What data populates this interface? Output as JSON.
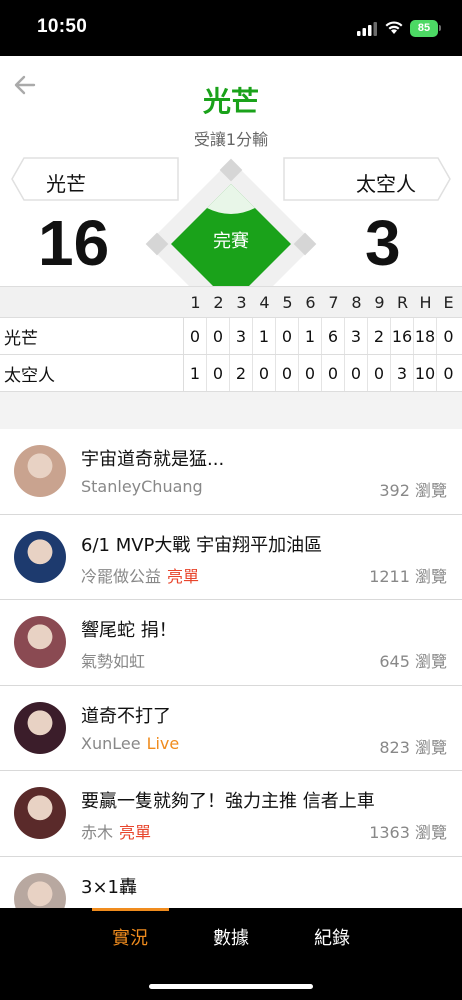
{
  "status_bar": {
    "time": "10:50",
    "battery": "85"
  },
  "header": {
    "title": "光芒",
    "handicap": "受讓1分輸",
    "home_team": "光芒",
    "away_team": "太空人",
    "home_score": "16",
    "away_score": "3",
    "game_status": "完賽",
    "accent_color": "#1aa21a"
  },
  "linescore": {
    "columns": [
      "1",
      "2",
      "3",
      "4",
      "5",
      "6",
      "7",
      "8",
      "9",
      "R",
      "H",
      "E"
    ],
    "rows": [
      {
        "team": "光芒",
        "cells": [
          "0",
          "0",
          "3",
          "1",
          "0",
          "1",
          "6",
          "3",
          "2",
          "16",
          "18",
          "0"
        ]
      },
      {
        "team": "太空人",
        "cells": [
          "1",
          "0",
          "2",
          "0",
          "0",
          "0",
          "0",
          "0",
          "0",
          "3",
          "10",
          "0"
        ]
      }
    ]
  },
  "posts": [
    {
      "title": "宇宙道奇就是猛...",
      "author": "StanleyChuang",
      "tag": "",
      "views": "392 瀏覽",
      "avatar_color": "#c9a38f"
    },
    {
      "title": "6/1 MVP大戰 宇宙翔平加油區",
      "author": "冷罷做公益",
      "tag": "亮單",
      "tag_color": "#e8452c",
      "views": "1211 瀏覽",
      "avatar_color": "#1d3a6e"
    },
    {
      "title": "響尾蛇 捐！",
      "author": "氣勢如虹",
      "tag": "",
      "views": "645 瀏覽",
      "avatar_color": "#8a4a52"
    },
    {
      "title": "道奇不打了",
      "author": "XunLee",
      "tag": "Live",
      "tag_color": "#f08c1e",
      "views": "823 瀏覽",
      "avatar_color": "#3b1d2a"
    },
    {
      "title": "要贏一隻就夠了！強力主推 信者上車",
      "author": "赤木",
      "tag": "亮單",
      "tag_color": "#e8452c",
      "views": "1363 瀏覽",
      "avatar_color": "#5a2a2a"
    },
    {
      "title": "3×1轟",
      "author": "",
      "tag": "",
      "views": "",
      "avatar_color": "#b8a8a0"
    }
  ],
  "tabs": [
    {
      "label": "實況",
      "active": true
    },
    {
      "label": "數據",
      "active": false
    },
    {
      "label": "紀錄",
      "active": false
    }
  ]
}
